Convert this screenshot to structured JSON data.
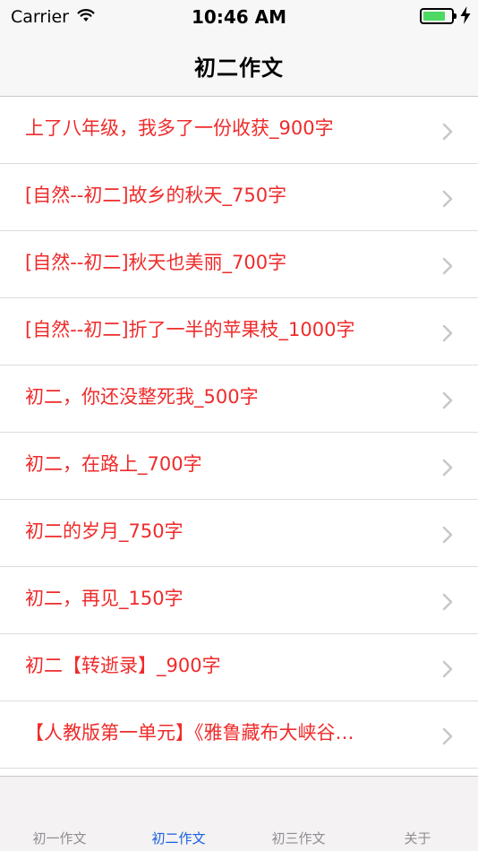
{
  "status": {
    "carrier": "Carrier",
    "time": "10:46 AM",
    "battery_level": 0.8,
    "battery_color": "#4cd964",
    "wifi_icon": "wifi-icon",
    "charge_icon": "lightning-icon"
  },
  "nav": {
    "title": "初二作文"
  },
  "list": {
    "title_color": "#ef2b2b",
    "accessory_icon": "chevron-right-icon",
    "items": [
      {
        "title": "上了八年级，我多了一份收获_900字"
      },
      {
        "title": "[自然--初二]故乡的秋天_750字"
      },
      {
        "title": "[自然--初二]秋天也美丽_700字"
      },
      {
        "title": "[自然--初二]折了一半的苹果枝_1000字"
      },
      {
        "title": "初二，你还没整死我_500字"
      },
      {
        "title": "初二，在路上_700字"
      },
      {
        "title": "初二的岁月_750字"
      },
      {
        "title": "初二，再见_150字"
      },
      {
        "title": "初二【转逝录】_900字"
      },
      {
        "title": "【人教版第一单元】《雅鲁藏布大峡谷…"
      }
    ]
  },
  "tabs": {
    "active_color": "#1a5fe0",
    "items": [
      {
        "label": "初一作文"
      },
      {
        "label": "初二作文",
        "active": true
      },
      {
        "label": "初三作文"
      },
      {
        "label": "关于"
      }
    ]
  }
}
